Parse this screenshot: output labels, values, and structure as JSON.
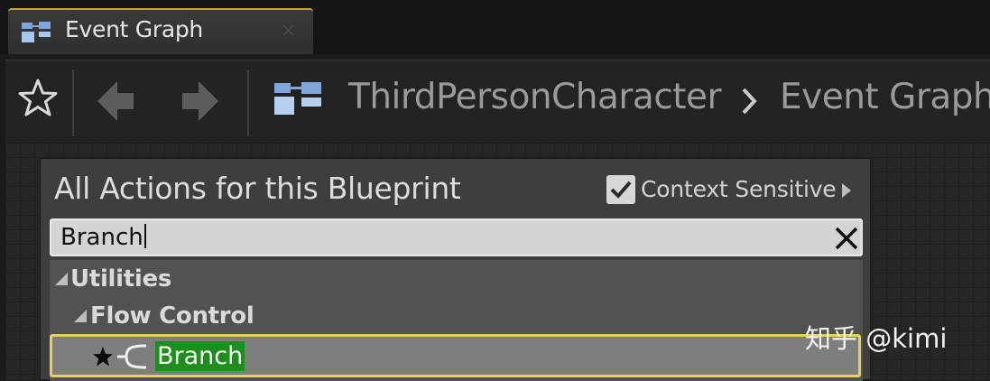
{
  "tab": {
    "title": "Event Graph",
    "close_glyph": "×",
    "icon": "graph-icon"
  },
  "toolbar": {
    "favorite_icon": "star-icon",
    "back_icon": "arrow-left-icon",
    "forward_icon": "arrow-right-icon"
  },
  "breadcrumb": {
    "icon": "graph-icon",
    "items": [
      "ThirdPersonCharacter",
      "Event Graph"
    ],
    "separator_icon": "chevron-right-icon"
  },
  "action_menu": {
    "title": "All Actions for this Blueprint",
    "context_sensitive": {
      "label": "Context Sensitive",
      "checked": true
    },
    "search": {
      "value": "Branch",
      "clear_icon": "close-icon"
    },
    "tree": {
      "category": "Utilities",
      "subcategory": "Flow Control",
      "selected_item": "Branch"
    }
  },
  "watermark": "知乎 @kimi",
  "colors": {
    "tab_accent": "#c8a53c",
    "selection_border": "#e6d25a",
    "match_highlight": "#1f8e1f"
  }
}
